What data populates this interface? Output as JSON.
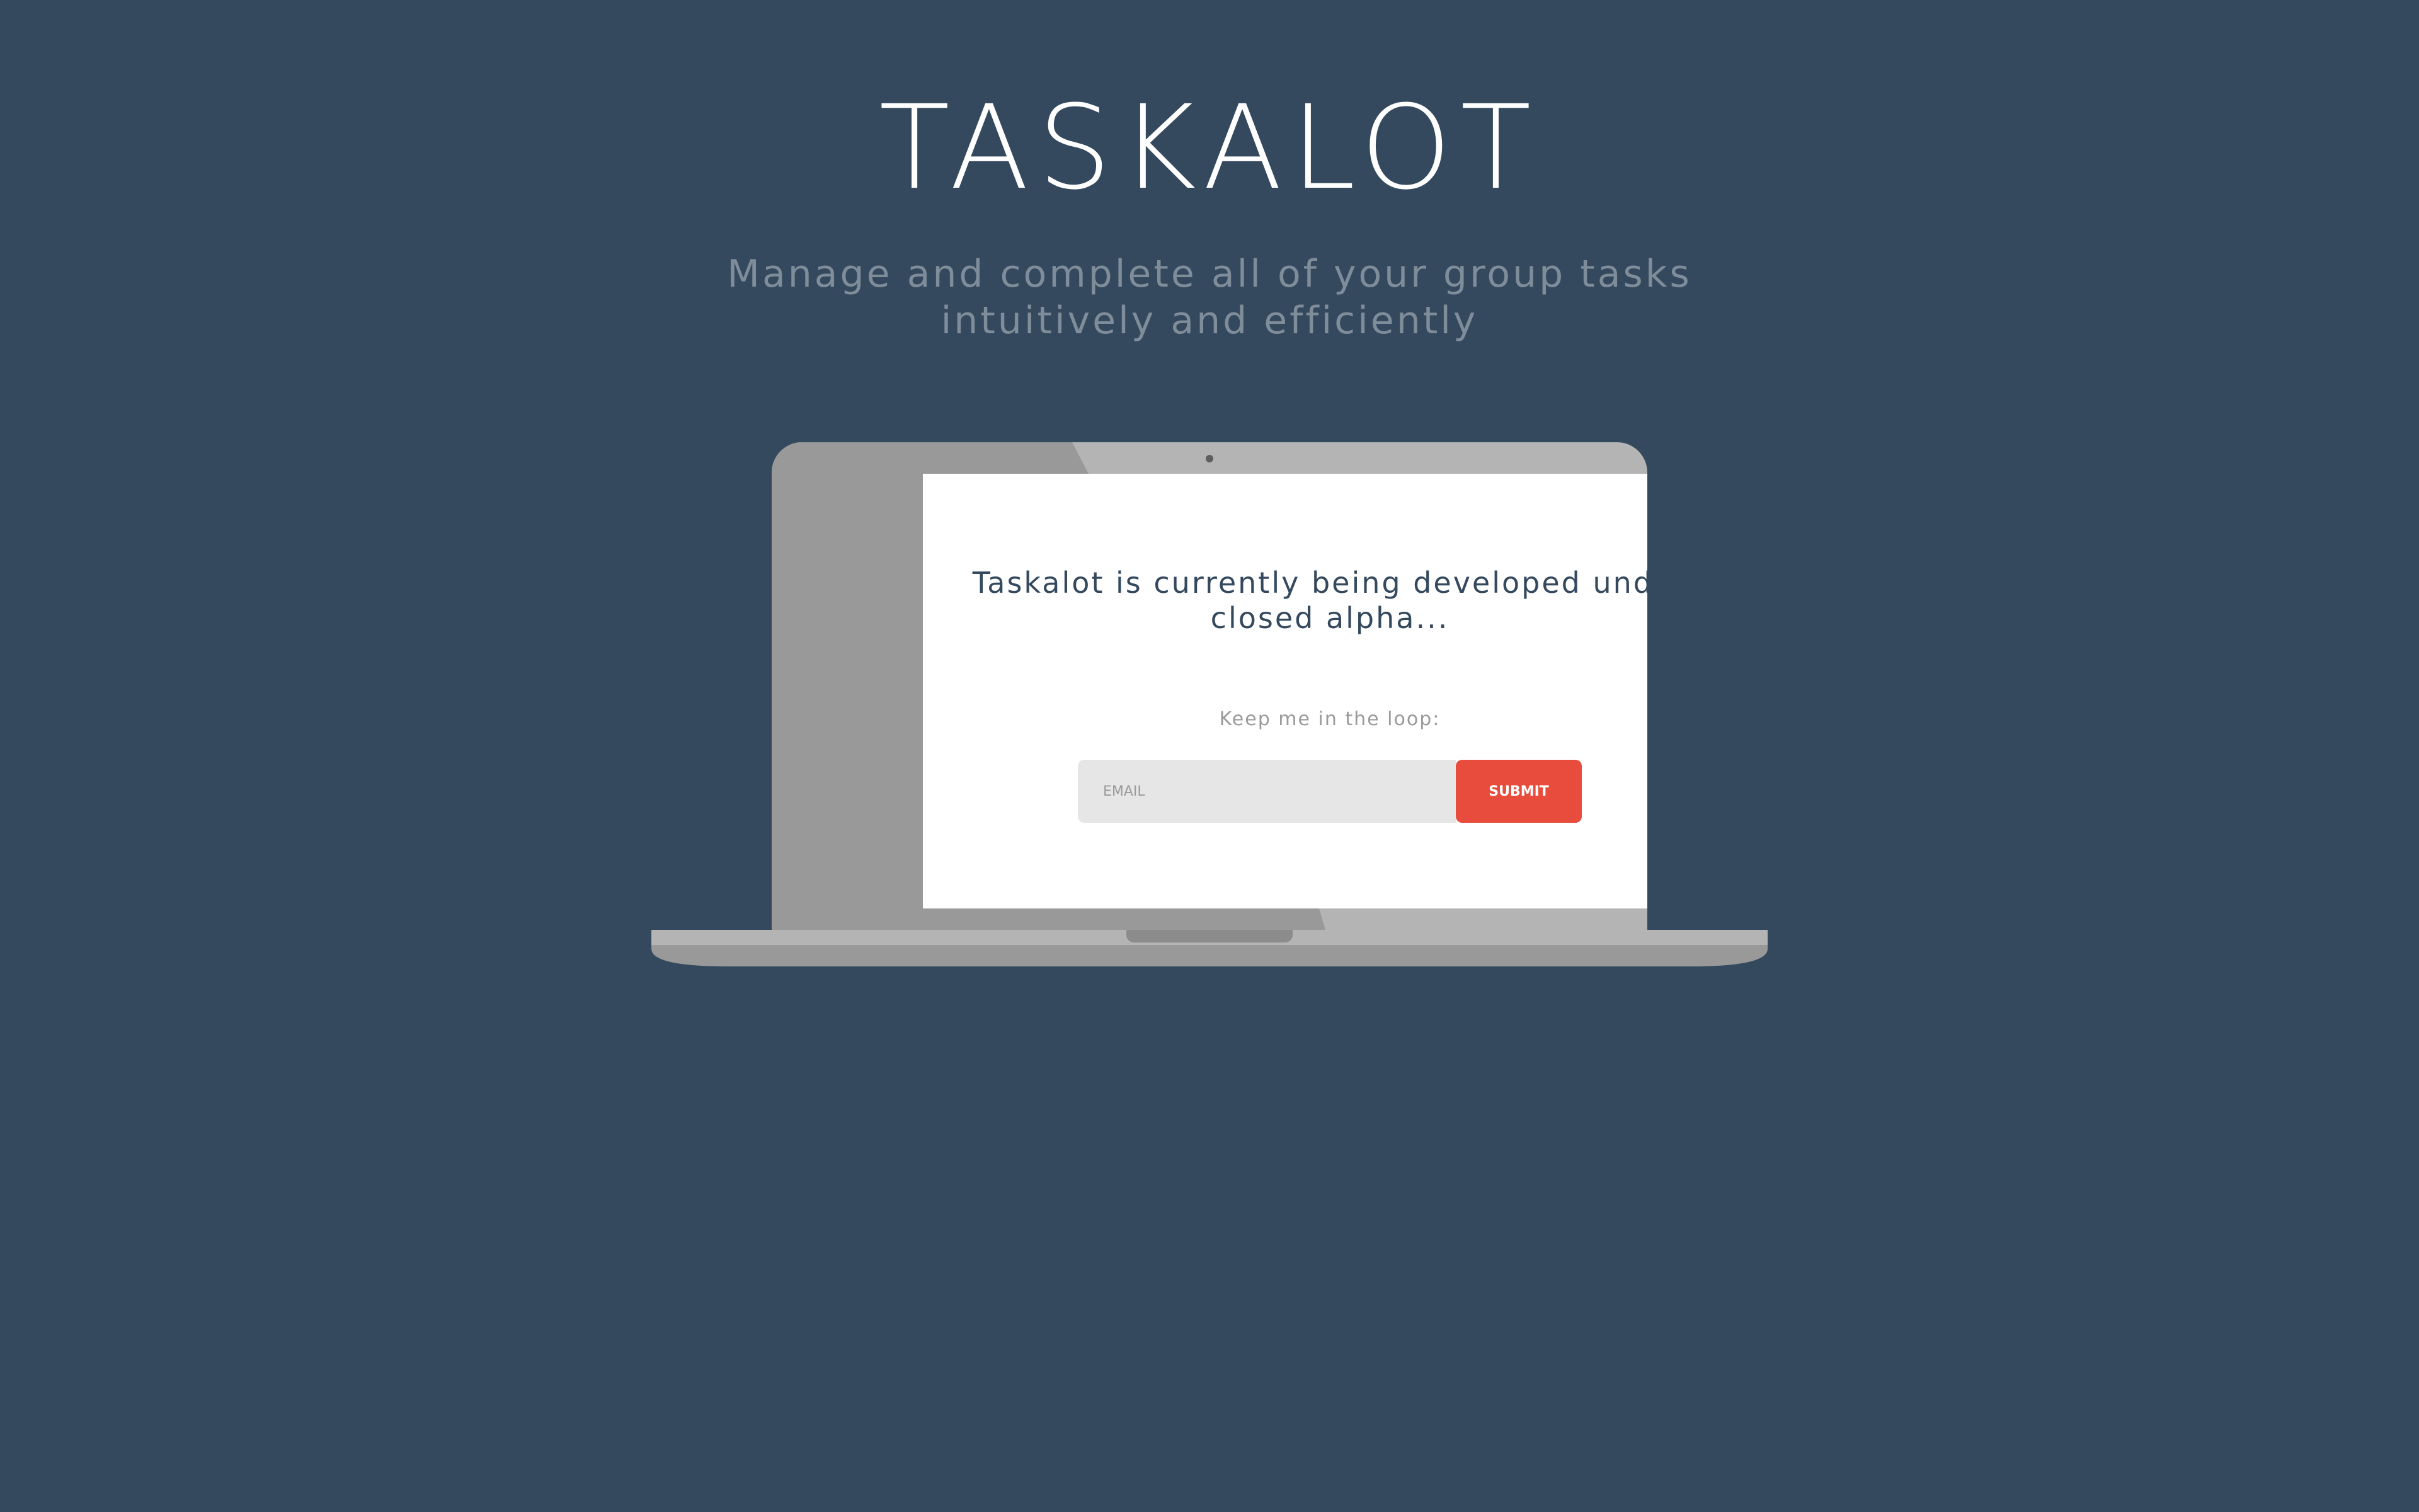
{
  "header": {
    "title": "TASKALOT",
    "tagline": "Manage and complete all of your group tasks intuitively and efficiently"
  },
  "screen": {
    "message": "Taskalot is currently being developed under closed alpha...",
    "loop_label": "Keep me in the loop:",
    "email_placeholder": "EMAIL",
    "email_value": "",
    "submit_label": "SUBMIT"
  },
  "colors": {
    "background": "#34495e",
    "title_text": "#ffffff",
    "tagline_text": "#7f8c99",
    "laptop_body": "#b4b4b4",
    "laptop_shadow": "#999999",
    "screen": "#ffffff",
    "input_background": "#e6e6e6",
    "submit_button": "#e74c3c"
  },
  "icons": {
    "camera": "laptop-camera-dot"
  }
}
